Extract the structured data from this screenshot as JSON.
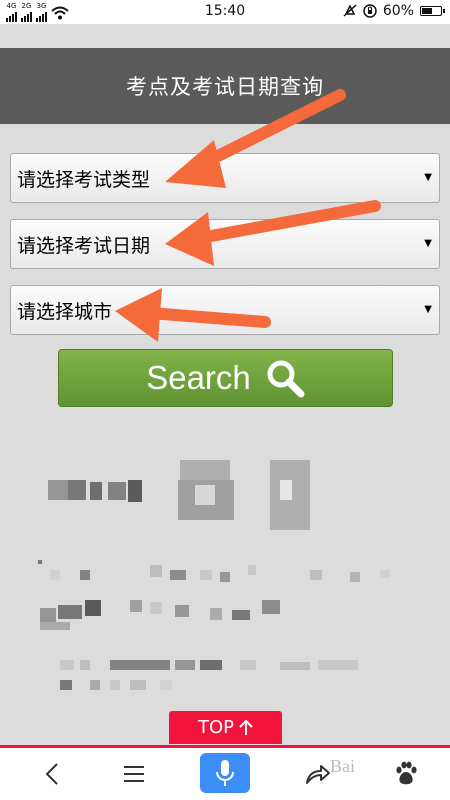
{
  "status_bar": {
    "signal_labels": [
      "4G",
      "2G",
      "3G"
    ],
    "time": "15:40",
    "battery_percent": "60%",
    "battery_level": 0.6
  },
  "page": {
    "title": "考点及考试日期查询"
  },
  "selects": [
    {
      "label": "请选择考试类型"
    },
    {
      "label": "请选择考试日期"
    },
    {
      "label": "请选择城市"
    }
  ],
  "search_button": {
    "label": "Search"
  },
  "top_button": {
    "label": "TOP"
  },
  "colors": {
    "header_bg": "#5a5a5a",
    "search_green": "#6fa23c",
    "top_red": "#f2143d",
    "mic_blue": "#3b8ef6",
    "arrow_orange": "#f46a3a"
  },
  "bottom_nav": {
    "icons": [
      "back-icon",
      "menu-icon",
      "mic-icon",
      "share-icon",
      "paw-icon"
    ],
    "watermark": "Bai"
  }
}
